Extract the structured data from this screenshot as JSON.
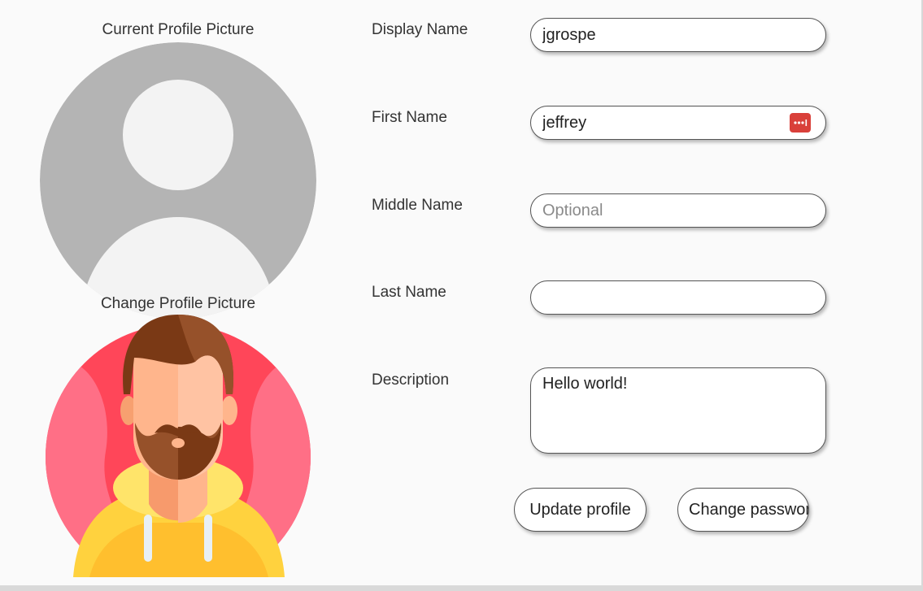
{
  "profile": {
    "current_label": "Current Profile Picture",
    "change_label": "Change Profile Picture"
  },
  "form": {
    "display_name": {
      "label": "Display Name",
      "value": "jgrospe"
    },
    "first_name": {
      "label": "First Name",
      "value": "jeffrey",
      "icon": "password-manager-icon"
    },
    "middle_name": {
      "label": "Middle Name",
      "value": "",
      "placeholder": "Optional"
    },
    "last_name": {
      "label": "Last Name",
      "value": ""
    },
    "description": {
      "label": "Description",
      "value": "Hello world!"
    }
  },
  "actions": {
    "update_label": "Update profile",
    "change_password_label": "Change password"
  },
  "colors": {
    "avatar_grey": "#b4b4b4",
    "avatar_light": "#f3f3f3",
    "badge_red": "#d9403a",
    "circle_pink": "#ff4659"
  }
}
